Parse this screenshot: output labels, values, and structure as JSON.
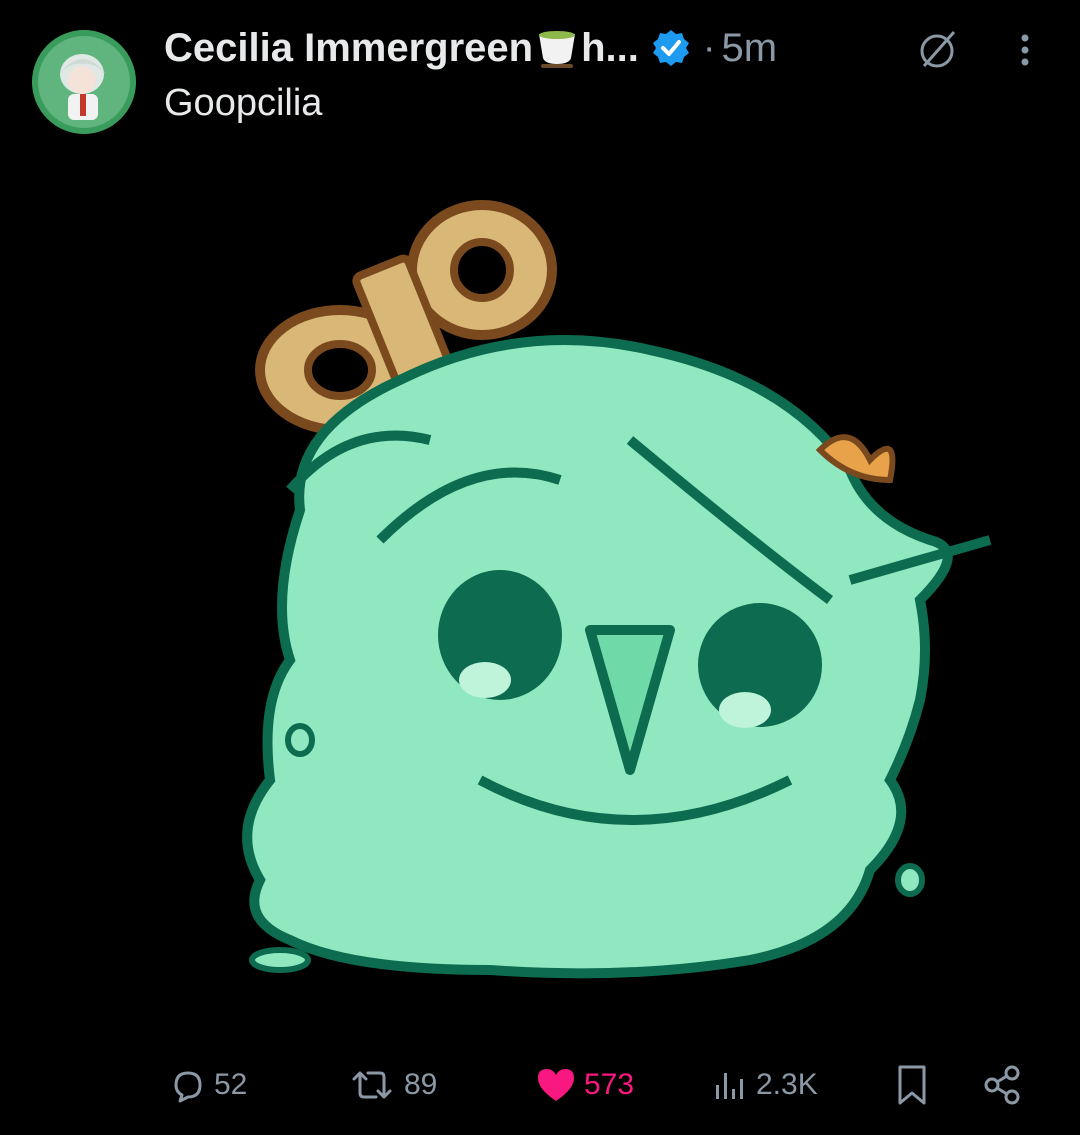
{
  "post": {
    "author_name": "Cecilia Immergreen",
    "author_suffix": "h...",
    "separator": "·",
    "time_ago": "5m",
    "text": "Goopcilia"
  },
  "icons": {
    "avatar": "avatar",
    "verified": "verified-badge-icon",
    "tea": "tea-cup-emoji",
    "filter": "slashed-circle-icon",
    "more": "more-vertical-icon"
  },
  "colors": {
    "background": "#000000",
    "text_primary": "#e7e9ea",
    "text_secondary": "#8b98a5",
    "verified": "#1d9bf0",
    "like": "#f91880",
    "slime": "#8fe8bf",
    "slime_outline": "#0d6b4f",
    "key": "#d9b777"
  },
  "actions": {
    "reply": {
      "count": "52",
      "icon": "reply-icon"
    },
    "repost": {
      "count": "89",
      "icon": "repost-icon"
    },
    "like": {
      "count": "573",
      "icon": "heart-icon"
    },
    "views": {
      "count": "2.3K",
      "icon": "views-icon"
    },
    "bookmark": {
      "icon": "bookmark-icon"
    },
    "share": {
      "icon": "share-icon"
    }
  }
}
